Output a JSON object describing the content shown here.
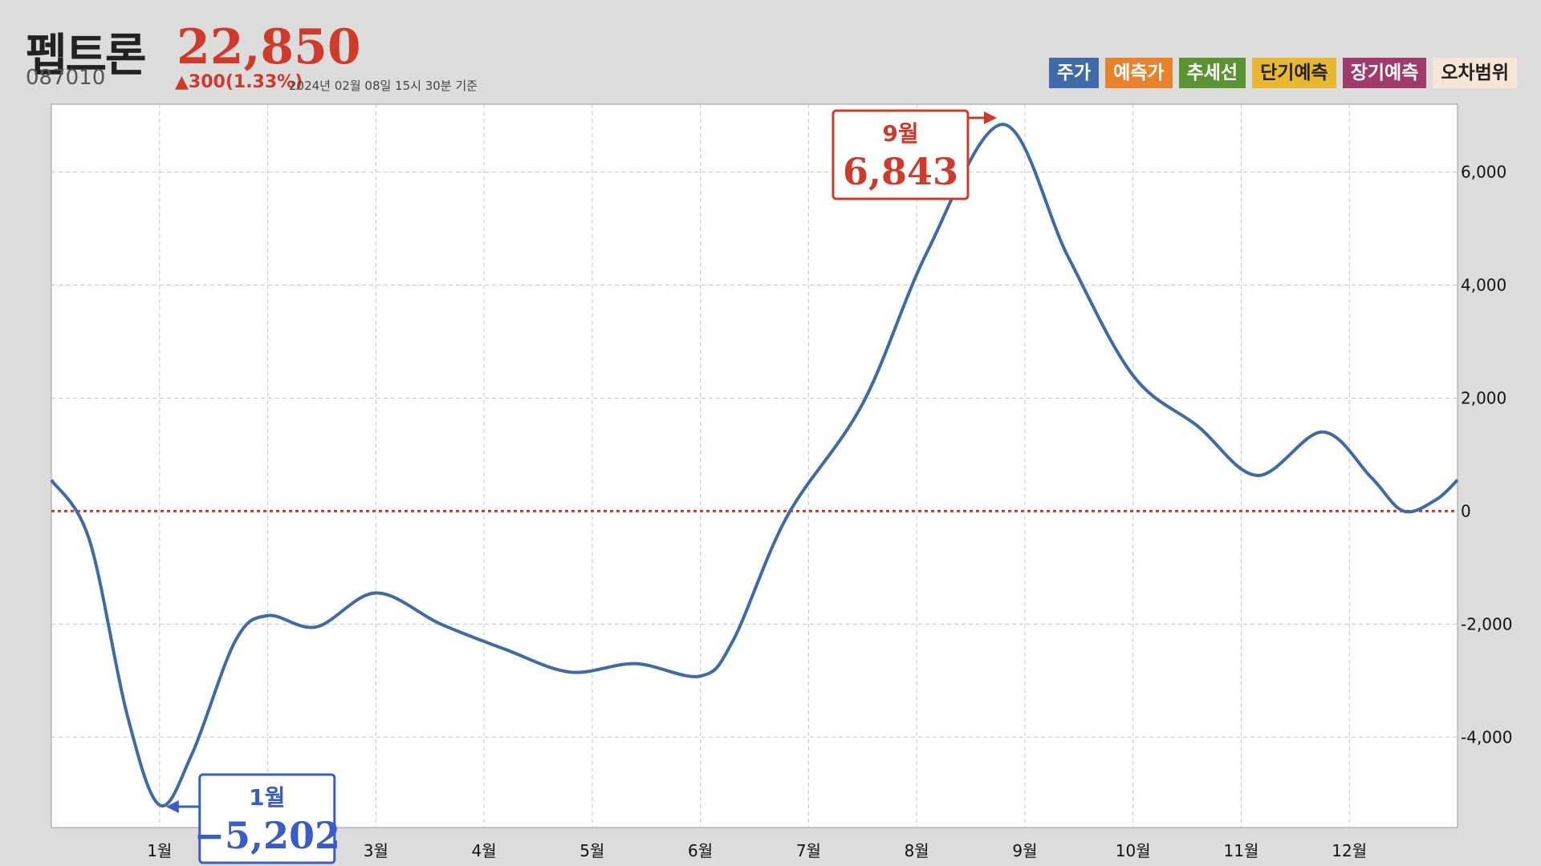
{
  "header": {
    "name": "펩트론",
    "price": "22,850",
    "code": "087010",
    "change": "▲300(1.33%)",
    "as_of": "2024년 02월 08일 15시 30분 기준"
  },
  "legend": [
    {
      "label": "주가",
      "bg": "#3e6aa8",
      "fg": "#ffffff"
    },
    {
      "label": "예측가",
      "bg": "#e8822a",
      "fg": "#ffffff"
    },
    {
      "label": "추세선",
      "bg": "#5a9432",
      "fg": "#ffffff"
    },
    {
      "label": "단기예측",
      "bg": "#e8b830",
      "fg": "#222222"
    },
    {
      "label": "장기예측",
      "bg": "#a03a6a",
      "fg": "#ffffff"
    },
    {
      "label": "오차범위",
      "bg": "#f7e6d6",
      "fg": "#222222"
    }
  ],
  "chart_data": {
    "type": "line",
    "x_labels": [
      "1월",
      "2월",
      "3월",
      "4월",
      "5월",
      "6월",
      "7월",
      "8월",
      "9월",
      "10월",
      "11월",
      "12월"
    ],
    "x_label_positions": [
      1,
      2,
      3,
      4,
      5,
      6,
      7,
      8,
      9,
      10,
      11,
      12
    ],
    "xlim": [
      0,
      13.0
    ],
    "ylim": [
      -5600,
      7200
    ],
    "y_ticks": [
      {
        "value": 6000,
        "label": "6,000"
      },
      {
        "value": 4000,
        "label": "4,000"
      },
      {
        "value": 2000,
        "label": "2,000"
      },
      {
        "value": 0,
        "label": "0"
      },
      {
        "value": -2000,
        "label": "-2,000"
      },
      {
        "value": -4000,
        "label": "-4,000"
      }
    ],
    "grid": true,
    "zero_line": true,
    "series": [
      {
        "color": "#3e6aa8",
        "points": [
          [
            0.0,
            550
          ],
          [
            0.35,
            -500
          ],
          [
            0.7,
            -3600
          ],
          [
            1.0,
            -5202
          ],
          [
            1.3,
            -4300
          ],
          [
            1.7,
            -2300
          ],
          [
            2.0,
            -1850
          ],
          [
            2.45,
            -2050
          ],
          [
            3.0,
            -1450
          ],
          [
            3.6,
            -2000
          ],
          [
            4.2,
            -2450
          ],
          [
            4.8,
            -2850
          ],
          [
            5.4,
            -2700
          ],
          [
            6.0,
            -2920
          ],
          [
            6.3,
            -2300
          ],
          [
            6.8,
            -100
          ],
          [
            7.5,
            1900
          ],
          [
            8.1,
            4600
          ],
          [
            8.8,
            6843
          ],
          [
            9.4,
            4500
          ],
          [
            10.0,
            2400
          ],
          [
            10.6,
            1500
          ],
          [
            11.15,
            630
          ],
          [
            11.75,
            1400
          ],
          [
            12.2,
            600
          ],
          [
            12.5,
            0
          ],
          [
            12.8,
            200
          ],
          [
            13.0,
            550
          ]
        ]
      }
    ],
    "annotations": [
      {
        "month": "9월",
        "value": "6,843",
        "x": 8.8,
        "y": 6843,
        "color": "#d03a2a"
      },
      {
        "month": "1월",
        "value": "−5,202",
        "x": 1.0,
        "y": -5202,
        "color": "#3a5cc8"
      }
    ]
  }
}
